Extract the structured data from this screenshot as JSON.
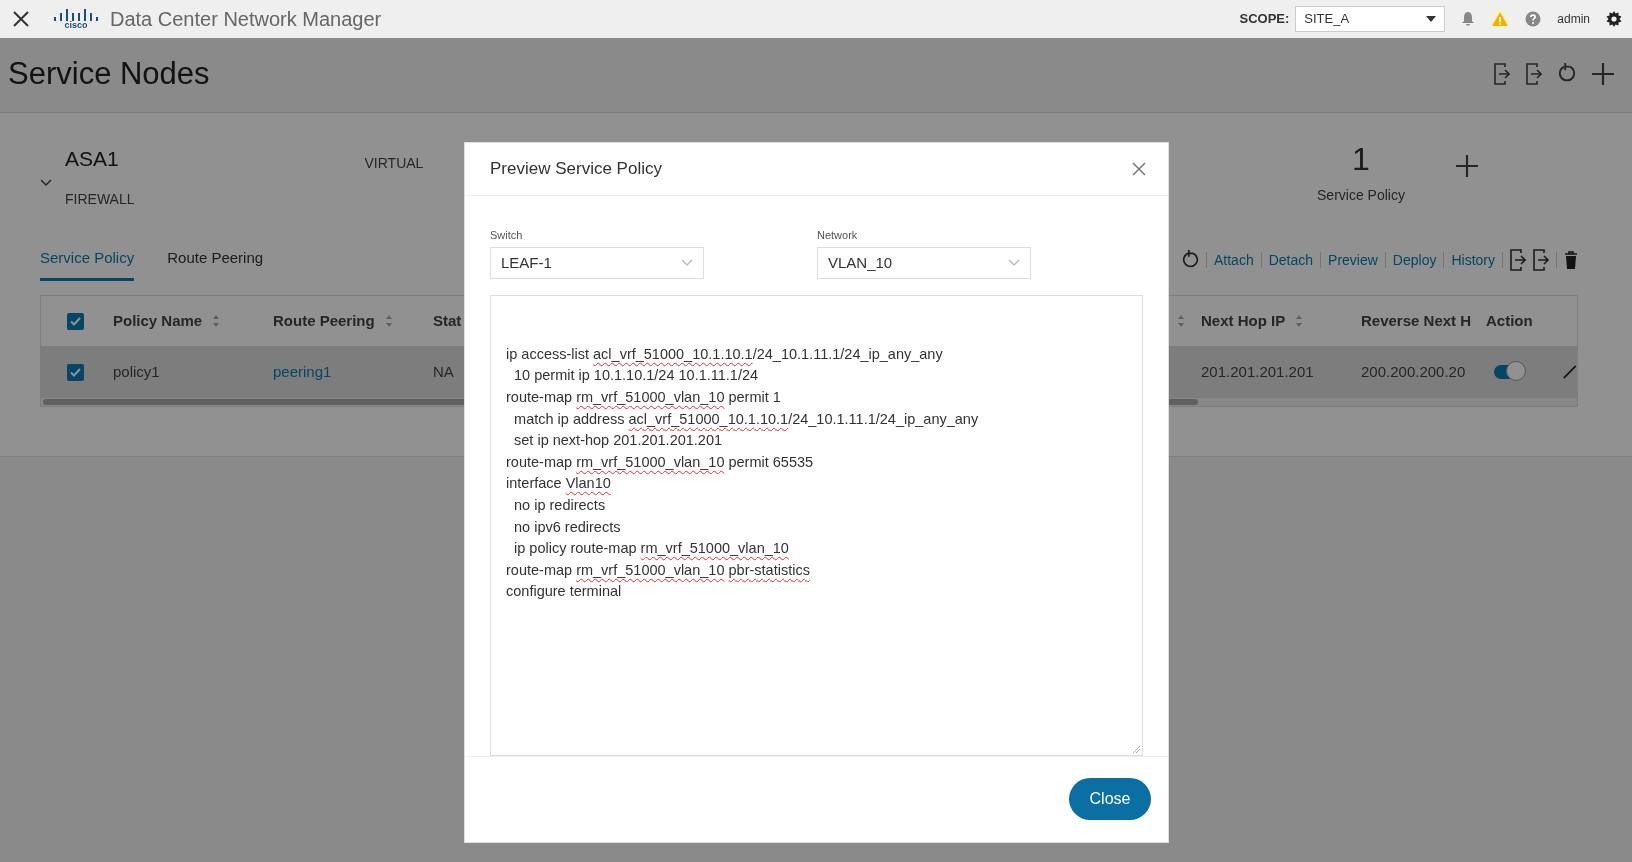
{
  "top_bar": {
    "logo_text": "cisco",
    "app_title": "Data Center Network Manager",
    "scope_label": "SCOPE:",
    "scope_value": "SITE_A",
    "user": "admin"
  },
  "page": {
    "title": "Service Nodes"
  },
  "node": {
    "name": "ASA1",
    "type": "FIREWALL",
    "mode": "VIRTUAL",
    "count": "1",
    "count_label": "Service Policy"
  },
  "tabs": [
    {
      "label": "Service Policy",
      "selected": true
    },
    {
      "label": "Route Peering",
      "selected": false
    }
  ],
  "toolbar_actions": [
    "Attach",
    "Detach",
    "Preview",
    "Deploy",
    "History"
  ],
  "table": {
    "all_selected": true,
    "columns": [
      {
        "label": "Policy Name",
        "sortable": true
      },
      {
        "label": "Route Peering",
        "sortable": true
      },
      {
        "label": "Stat"
      },
      {
        "sortable": true
      },
      {
        "label": "Next Hop IP",
        "sortable": true
      },
      {
        "label": "Reverse Next H"
      },
      {
        "label": "Action"
      }
    ],
    "rows": [
      {
        "selected": true,
        "enabled": true,
        "cells": [
          {
            "kind": "text",
            "text": "policy1"
          },
          {
            "kind": "link",
            "text": "peering1"
          },
          {
            "kind": "text",
            "text": "NA"
          },
          {
            "kind": "empty"
          },
          {
            "kind": "text",
            "text": "201.201.201.201"
          },
          {
            "kind": "text",
            "text": "200.200.200.20"
          },
          {
            "kind": "action"
          }
        ]
      }
    ]
  },
  "dialog": {
    "title": "Preview Service Policy",
    "fields": [
      {
        "label": "Switch",
        "value": "LEAF-1"
      },
      {
        "label": "Network",
        "value": "VLAN_10"
      }
    ],
    "preview_lines": [
      [
        {
          "text": "ip access-list "
        },
        {
          "text": "acl_vrf_51000_10.1.10.1",
          "flagged": true
        },
        {
          "text": "/24_10.1.11.1/24_ip_any_any"
        }
      ],
      [
        {
          "text": "  10 permit ip 10.1.10.1/24 10.1.11.1/24"
        }
      ],
      [
        {
          "text": "route-map "
        },
        {
          "text": "rm_vrf_51000_vlan_10",
          "flagged": true
        },
        {
          "text": " permit 1"
        }
      ],
      [
        {
          "text": "  match ip address "
        },
        {
          "text": "acl_vrf_51000_10.1.10.1",
          "flagged": true
        },
        {
          "text": "/24_10.1.11.1/24_ip_any_any"
        }
      ],
      [
        {
          "text": "  set ip next-hop 201.201.201.201"
        }
      ],
      [
        {
          "text": "route-map "
        },
        {
          "text": "rm_vrf_51000_vlan_10",
          "flagged": true
        },
        {
          "text": " permit 65535"
        }
      ],
      [
        {
          "text": "interface "
        },
        {
          "text": "Vlan10",
          "flagged": true
        }
      ],
      [
        {
          "text": "  no ip redirects"
        }
      ],
      [
        {
          "text": "  no ipv6 redirects"
        }
      ],
      [
        {
          "text": "  ip policy route-map "
        },
        {
          "text": "rm_vrf_51000_vlan_10",
          "flagged": true
        }
      ],
      [
        {
          "text": "route-map "
        },
        {
          "text": "rm_vrf_51000_vlan_10",
          "flagged": true
        },
        {
          "text": "pbr-statistics",
          "flagged": true,
          "spaced": true
        }
      ],
      [
        {
          "text": "configure terminal"
        }
      ]
    ],
    "button": "Close"
  }
}
